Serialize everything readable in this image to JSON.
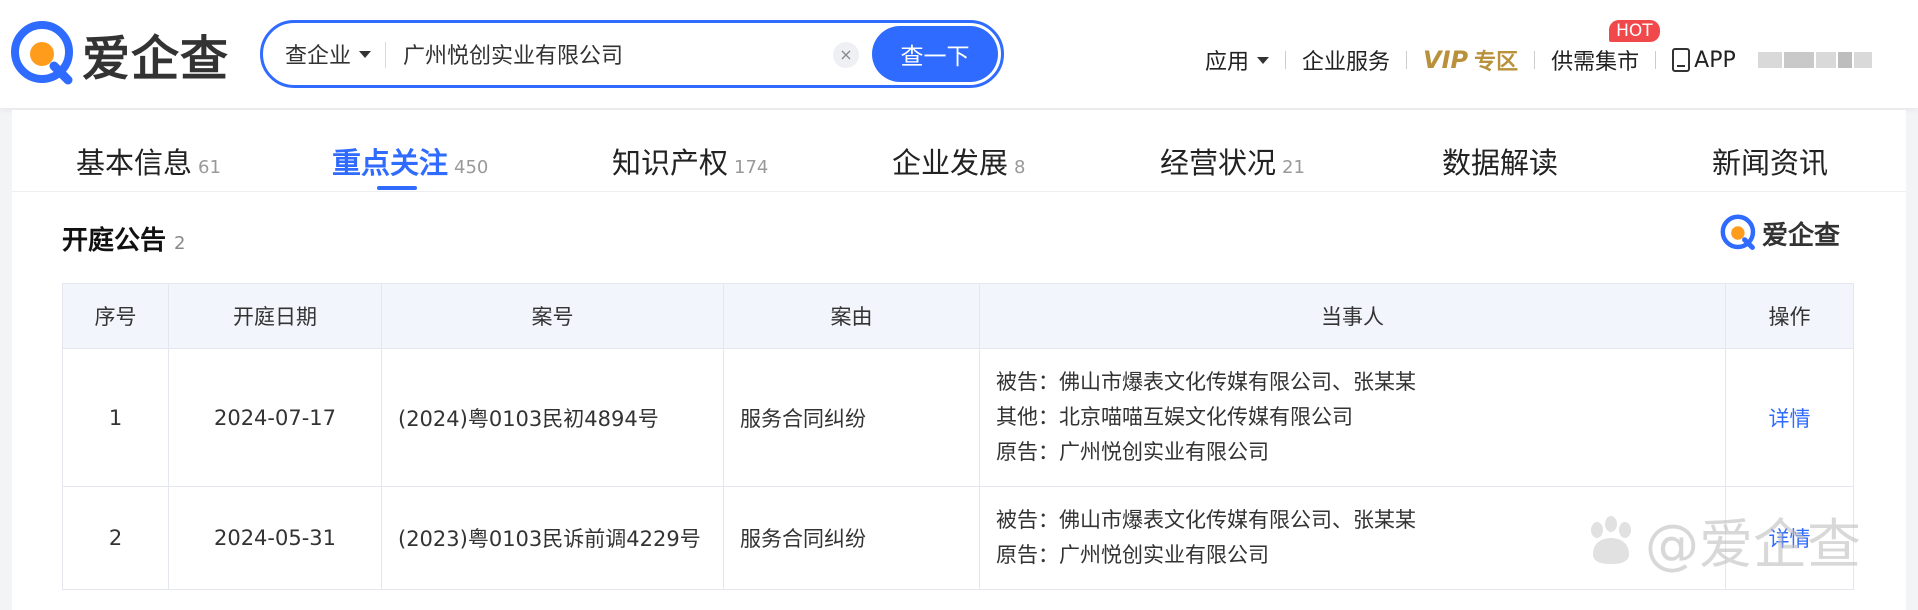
{
  "header": {
    "logo_text": "爱企查",
    "search": {
      "type_label": "查企业",
      "value": "广州悦创实业有限公司",
      "clear_label": "×",
      "button_label": "查一下"
    },
    "nav": {
      "apps": "应用",
      "enterprise_service": "企业服务",
      "vip_mark": "VIP",
      "vip_label": "专区",
      "supply": "供需集市",
      "hot_badge": "HOT",
      "app": "APP"
    }
  },
  "tabs": [
    {
      "label": "基本信息",
      "count": "61"
    },
    {
      "label": "重点关注",
      "count": "450"
    },
    {
      "label": "知识产权",
      "count": "174"
    },
    {
      "label": "企业发展",
      "count": "8"
    },
    {
      "label": "经营状况",
      "count": "21"
    },
    {
      "label": "数据解读",
      "count": ""
    },
    {
      "label": "新闻资讯",
      "count": ""
    }
  ],
  "section": {
    "title": "开庭公告",
    "count": "2",
    "brand": "爱企查"
  },
  "table": {
    "headers": [
      "序号",
      "开庭日期",
      "案号",
      "案由",
      "当事人",
      "操作"
    ],
    "rows": [
      {
        "num": "1",
        "date": "2024-07-17",
        "case_no": "(2024)粤0103民初4894号",
        "reason": "服务合同纠纷",
        "parties": [
          "被告：佛山市爆表文化传媒有限公司、张某某",
          "其他：北京喵喵互娱文化传媒有限公司",
          "原告：广州悦创实业有限公司"
        ],
        "action": "详情"
      },
      {
        "num": "2",
        "date": "2024-05-31",
        "case_no": "(2023)粤0103民诉前调4229号",
        "reason": "服务合同纠纷",
        "parties": [
          "被告：佛山市爆表文化传媒有限公司、张某某",
          "原告：广州悦创实业有限公司"
        ],
        "action": "详情"
      }
    ]
  },
  "watermark": "@爱企查",
  "colors": {
    "accent": "#2f6bff",
    "vip": "#b8913a",
    "hot": "#f0484b",
    "logo_orange": "#ff9c1b"
  }
}
